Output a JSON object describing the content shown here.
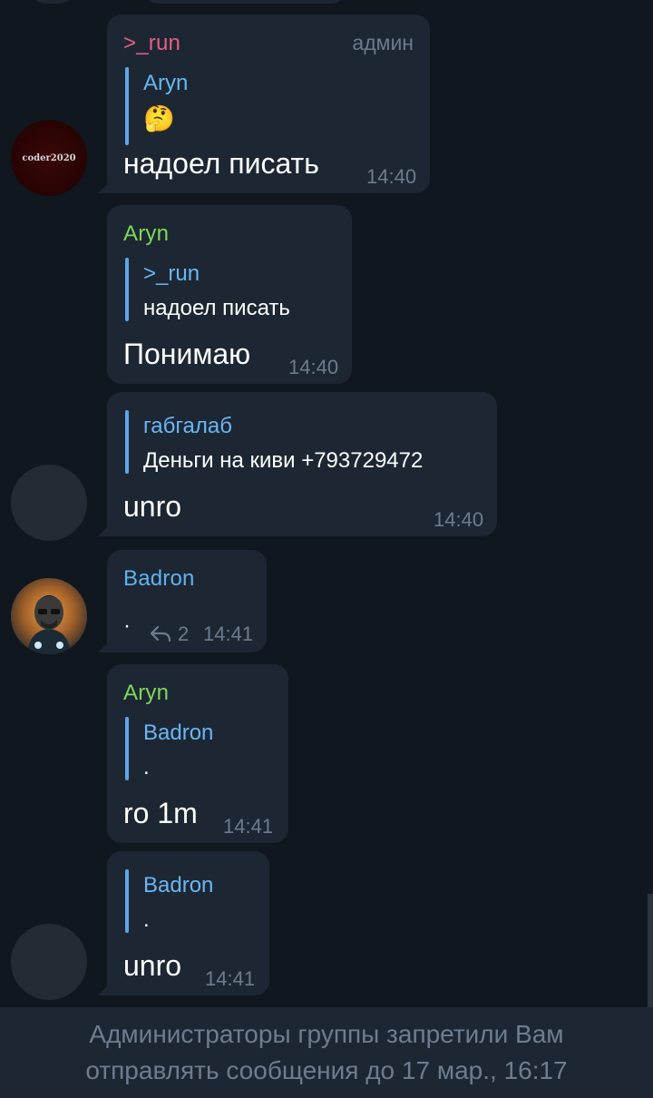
{
  "messages": [
    {
      "sender": ">_run",
      "sender_color": "#e85d87",
      "role": "админ",
      "quote_name": "Aryn",
      "quote_text": "🤔",
      "text": "надоел писать",
      "time": "14:40",
      "avatar_label": "coder2020"
    },
    {
      "sender": "Aryn",
      "sender_color": "#7ed957",
      "quote_name": ">_run",
      "quote_text": "надоел писать",
      "text": "Понимаю",
      "time": "14:40"
    },
    {
      "quote_name": "габгалаб",
      "quote_text": "Деньги на киви +793729472",
      "text": "unro",
      "time": "14:40"
    },
    {
      "sender": "Badron",
      "sender_color": "#5fb3f0",
      "text": "·",
      "reply_count": "2",
      "time": "14:41"
    },
    {
      "sender": "Aryn",
      "sender_color": "#7ed957",
      "quote_name": "Badron",
      "quote_text": ".",
      "text": "ro 1m",
      "time": "14:41"
    },
    {
      "quote_name": "Badron",
      "quote_text": ".",
      "text": "unro",
      "time": "14:41"
    }
  ],
  "footer": {
    "line1": "Администраторы группы запретили Вам",
    "line2": "отправлять сообщения до 17 мар., 16:17"
  },
  "icons": {
    "reply": "reply-arrow-icon"
  }
}
